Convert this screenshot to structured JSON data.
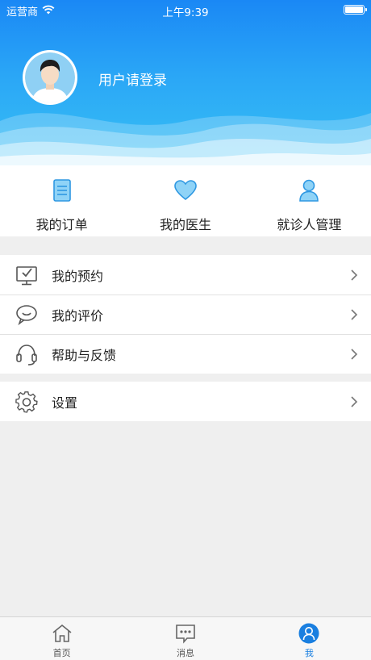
{
  "status_bar": {
    "carrier": "运营商",
    "time": "上午9:39"
  },
  "profile": {
    "login_prompt": "用户请登录"
  },
  "quick_actions": [
    {
      "label": "我的订单",
      "icon": "order-list-icon"
    },
    {
      "label": "我的医生",
      "icon": "heart-icon"
    },
    {
      "label": "就诊人管理",
      "icon": "person-icon"
    }
  ],
  "menu_group_1": [
    {
      "label": "我的预约",
      "icon": "monitor-check-icon"
    },
    {
      "label": "我的评价",
      "icon": "chat-bubble-icon"
    },
    {
      "label": "帮助与反馈",
      "icon": "headset-icon"
    }
  ],
  "menu_group_2": [
    {
      "label": "设置",
      "icon": "gear-icon"
    }
  ],
  "tab_bar": [
    {
      "label": "首页",
      "icon": "home-icon",
      "active": false
    },
    {
      "label": "消息",
      "icon": "message-icon",
      "active": false
    },
    {
      "label": "我",
      "icon": "user-icon",
      "active": true
    }
  ],
  "colors": {
    "primary": "#1a88f5",
    "accent_icon": "#3aa6ee",
    "active_tab": "#1a7fe0"
  }
}
